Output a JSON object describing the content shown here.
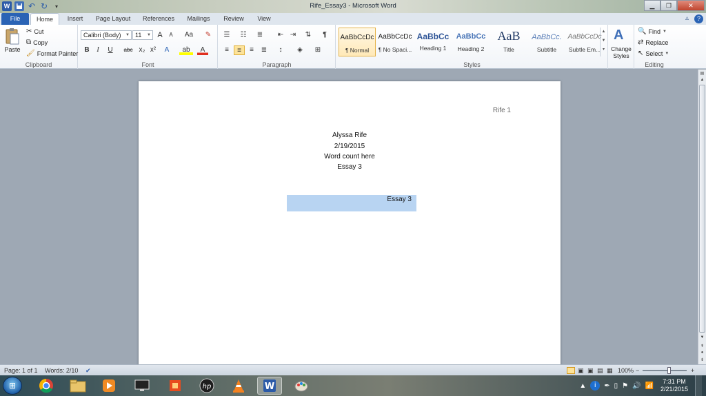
{
  "window": {
    "title": "Rife_Essay3  -  Microsoft Word"
  },
  "qat": {
    "word_icon": "W",
    "undo": "↶",
    "redo": "↻",
    "more": "▾"
  },
  "tabs": [
    {
      "label": "File"
    },
    {
      "label": "Home"
    },
    {
      "label": "Insert"
    },
    {
      "label": "Page Layout"
    },
    {
      "label": "References"
    },
    {
      "label": "Mailings"
    },
    {
      "label": "Review"
    },
    {
      "label": "View"
    }
  ],
  "clipboard": {
    "label": "Clipboard",
    "paste": "Paste",
    "cut": "Cut",
    "copy": "Copy",
    "format_painter": "Format Painter"
  },
  "font": {
    "label": "Font",
    "family": "Calibri (Body)",
    "size": "11",
    "bold": "B",
    "italic": "I",
    "underline": "U",
    "strike": "abc",
    "subscript": "x₂",
    "superscript": "x²",
    "grow": "A",
    "shrink": "A",
    "case": "Aa",
    "clear": "✎",
    "highlight": "ab",
    "color": "A"
  },
  "paragraph": {
    "label": "Paragraph",
    "pilcrow": "¶"
  },
  "styles": {
    "label": "Styles",
    "items": [
      {
        "sample": "AaBbCcDc",
        "name": "¶ Normal"
      },
      {
        "sample": "AaBbCcDc",
        "name": "¶ No Spaci..."
      },
      {
        "sample": "AaBbCc",
        "name": "Heading 1"
      },
      {
        "sample": "AaBbCc",
        "name": "Heading 2"
      },
      {
        "sample": "AaB",
        "name": "Title"
      },
      {
        "sample": "AaBbCc.",
        "name": "Subtitle"
      },
      {
        "sample": "AaBbCcDc",
        "name": "Subtle Em..."
      }
    ],
    "change_styles": "Change Styles"
  },
  "editing": {
    "label": "Editing",
    "find": "Find",
    "replace": "Replace",
    "select": "Select"
  },
  "document": {
    "header": "Rife 1",
    "lines": [
      "Alyssa Rife",
      "2/19/2015",
      "Word count here",
      "Essay 3"
    ],
    "selected_title": "Essay 3"
  },
  "status": {
    "page": "Page: 1 of 1",
    "words": "Words: 2/10",
    "zoom": "100%",
    "zoom_minus": "−",
    "zoom_plus": "+"
  },
  "taskbar": {
    "time": "7:31 PM",
    "date": "2/21/2015"
  },
  "colors": {
    "file_tab": "#2a63b5",
    "selection": "#b8d4f2",
    "doc_background": "#9ea8b4"
  }
}
